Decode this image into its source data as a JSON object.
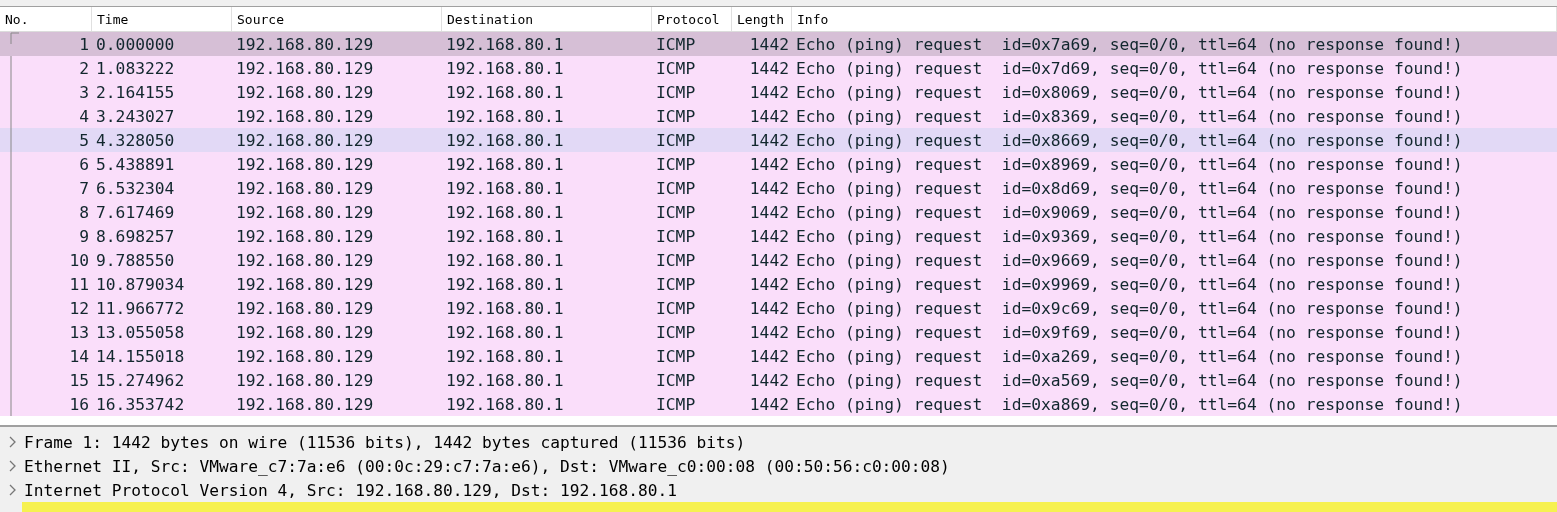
{
  "packet_list": {
    "columns": [
      "No.",
      "Time",
      "Source",
      "Destination",
      "Protocol",
      "Length",
      "Info"
    ],
    "rows": [
      {
        "no": "1",
        "time": "0.000000",
        "source": "192.168.80.129",
        "destination": "192.168.80.1",
        "protocol": "ICMP",
        "length": "1442",
        "info": "Echo (ping) request  id=0x7a69, seq=0/0, ttl=64 (no response found!)",
        "selected": true,
        "hovered": false
      },
      {
        "no": "2",
        "time": "1.083222",
        "source": "192.168.80.129",
        "destination": "192.168.80.1",
        "protocol": "ICMP",
        "length": "1442",
        "info": "Echo (ping) request  id=0x7d69, seq=0/0, ttl=64 (no response found!)",
        "selected": false,
        "hovered": false
      },
      {
        "no": "3",
        "time": "2.164155",
        "source": "192.168.80.129",
        "destination": "192.168.80.1",
        "protocol": "ICMP",
        "length": "1442",
        "info": "Echo (ping) request  id=0x8069, seq=0/0, ttl=64 (no response found!)",
        "selected": false,
        "hovered": false
      },
      {
        "no": "4",
        "time": "3.243027",
        "source": "192.168.80.129",
        "destination": "192.168.80.1",
        "protocol": "ICMP",
        "length": "1442",
        "info": "Echo (ping) request  id=0x8369, seq=0/0, ttl=64 (no response found!)",
        "selected": false,
        "hovered": false
      },
      {
        "no": "5",
        "time": "4.328050",
        "source": "192.168.80.129",
        "destination": "192.168.80.1",
        "protocol": "ICMP",
        "length": "1442",
        "info": "Echo (ping) request  id=0x8669, seq=0/0, ttl=64 (no response found!)",
        "selected": false,
        "hovered": true
      },
      {
        "no": "6",
        "time": "5.438891",
        "source": "192.168.80.129",
        "destination": "192.168.80.1",
        "protocol": "ICMP",
        "length": "1442",
        "info": "Echo (ping) request  id=0x8969, seq=0/0, ttl=64 (no response found!)",
        "selected": false,
        "hovered": false
      },
      {
        "no": "7",
        "time": "6.532304",
        "source": "192.168.80.129",
        "destination": "192.168.80.1",
        "protocol": "ICMP",
        "length": "1442",
        "info": "Echo (ping) request  id=0x8d69, seq=0/0, ttl=64 (no response found!)",
        "selected": false,
        "hovered": false
      },
      {
        "no": "8",
        "time": "7.617469",
        "source": "192.168.80.129",
        "destination": "192.168.80.1",
        "protocol": "ICMP",
        "length": "1442",
        "info": "Echo (ping) request  id=0x9069, seq=0/0, ttl=64 (no response found!)",
        "selected": false,
        "hovered": false
      },
      {
        "no": "9",
        "time": "8.698257",
        "source": "192.168.80.129",
        "destination": "192.168.80.1",
        "protocol": "ICMP",
        "length": "1442",
        "info": "Echo (ping) request  id=0x9369, seq=0/0, ttl=64 (no response found!)",
        "selected": false,
        "hovered": false
      },
      {
        "no": "10",
        "time": "9.788550",
        "source": "192.168.80.129",
        "destination": "192.168.80.1",
        "protocol": "ICMP",
        "length": "1442",
        "info": "Echo (ping) request  id=0x9669, seq=0/0, ttl=64 (no response found!)",
        "selected": false,
        "hovered": false
      },
      {
        "no": "11",
        "time": "10.879034",
        "source": "192.168.80.129",
        "destination": "192.168.80.1",
        "protocol": "ICMP",
        "length": "1442",
        "info": "Echo (ping) request  id=0x9969, seq=0/0, ttl=64 (no response found!)",
        "selected": false,
        "hovered": false
      },
      {
        "no": "12",
        "time": "11.966772",
        "source": "192.168.80.129",
        "destination": "192.168.80.1",
        "protocol": "ICMP",
        "length": "1442",
        "info": "Echo (ping) request  id=0x9c69, seq=0/0, ttl=64 (no response found!)",
        "selected": false,
        "hovered": false
      },
      {
        "no": "13",
        "time": "13.055058",
        "source": "192.168.80.129",
        "destination": "192.168.80.1",
        "protocol": "ICMP",
        "length": "1442",
        "info": "Echo (ping) request  id=0x9f69, seq=0/0, ttl=64 (no response found!)",
        "selected": false,
        "hovered": false
      },
      {
        "no": "14",
        "time": "14.155018",
        "source": "192.168.80.129",
        "destination": "192.168.80.1",
        "protocol": "ICMP",
        "length": "1442",
        "info": "Echo (ping) request  id=0xa269, seq=0/0, ttl=64 (no response found!)",
        "selected": false,
        "hovered": false
      },
      {
        "no": "15",
        "time": "15.274962",
        "source": "192.168.80.129",
        "destination": "192.168.80.1",
        "protocol": "ICMP",
        "length": "1442",
        "info": "Echo (ping) request  id=0xa569, seq=0/0, ttl=64 (no response found!)",
        "selected": false,
        "hovered": false
      },
      {
        "no": "16",
        "time": "16.353742",
        "source": "192.168.80.129",
        "destination": "192.168.80.1",
        "protocol": "ICMP",
        "length": "1442",
        "info": "Echo (ping) request  id=0xa869, seq=0/0, ttl=64 (no response found!)",
        "selected": false,
        "hovered": false
      }
    ]
  },
  "packet_details": [
    {
      "text": "Frame 1: 1442 bytes on wire (11536 bits), 1442 bytes captured (11536 bits)",
      "expanded": false,
      "selected": false
    },
    {
      "text": "Ethernet II, Src: VMware_c7:7a:e6 (00:0c:29:c7:7a:e6), Dst: VMware_c0:00:08 (00:50:56:c0:00:08)",
      "expanded": false,
      "selected": false
    },
    {
      "text": "Internet Protocol Version 4, Src: 192.168.80.129, Dst: 192.168.80.1",
      "expanded": false,
      "selected": false
    }
  ]
}
